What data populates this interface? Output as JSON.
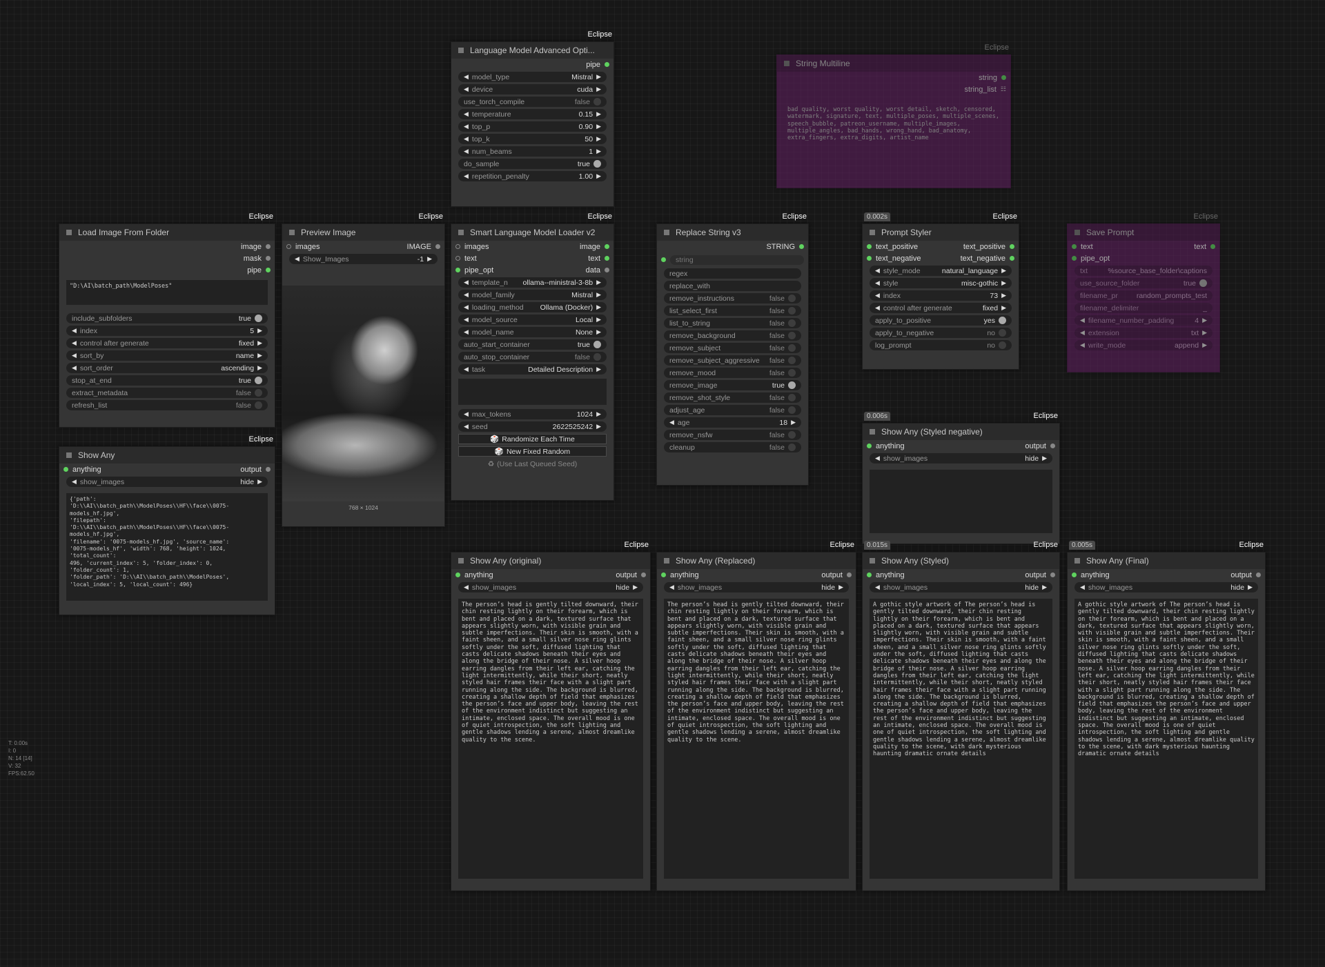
{
  "badge": "Eclipse",
  "stats": [
    "T: 0.00s",
    "I: 0",
    "N: 14 [14]",
    "V: 32",
    "FPS:62.50"
  ],
  "lmao": {
    "title": "Language Model Advanced Opti...",
    "out": "pipe",
    "w": [
      {
        "label": "model_type",
        "value": "Mistral"
      },
      {
        "label": "device",
        "value": "cuda"
      },
      {
        "label": "use_torch_compile",
        "value": "false"
      },
      {
        "label": "temperature",
        "value": "0.15"
      },
      {
        "label": "top_p",
        "value": "0.90"
      },
      {
        "label": "top_k",
        "value": "50"
      },
      {
        "label": "num_beams",
        "value": "1"
      },
      {
        "label": "do_sample",
        "value": "true"
      },
      {
        "label": "repetition_penalty",
        "value": "1.00"
      }
    ]
  },
  "strml": {
    "title": "String Multiline",
    "out1": "string",
    "out2": "string_list",
    "text": "bad quality, worst quality, worst detail, sketch, censored, watermark, signature, text, multiple_poses, multiple_scenes, speech_bubble, patreon_username, multiple_images, multiple_angles, bad_hands, wrong_hand, bad_anatomy, extra_fingers, extra_digits, artist_name"
  },
  "lif": {
    "title": "Load Image From Folder",
    "outs": [
      "image",
      "mask",
      "pipe"
    ],
    "path": "\"D:\\AI\\batch_path\\ModelPoses\"",
    "w": [
      {
        "label": "include_subfolders",
        "value": "true"
      },
      {
        "label": "index",
        "value": "5"
      },
      {
        "label": "control after generate",
        "value": "fixed"
      },
      {
        "label": "sort_by",
        "value": "name"
      },
      {
        "label": "sort_order",
        "value": "ascending"
      },
      {
        "label": "stop_at_end",
        "value": "true"
      },
      {
        "label": "extract_metadata",
        "value": "false"
      },
      {
        "label": "refresh_list",
        "value": "false"
      }
    ]
  },
  "prev": {
    "title": "Preview Image",
    "in": "images",
    "out": "IMAGE",
    "w": {
      "label": "Show_Images",
      "value": "-1"
    },
    "dims": "768 × 1024"
  },
  "slml": {
    "title": "Smart Language Model Loader v2",
    "ios": [
      [
        "images",
        "image"
      ],
      [
        "text",
        "text"
      ],
      [
        "pipe_opt",
        "data"
      ]
    ],
    "w": [
      {
        "label": "template_n",
        "value": "ollama--ministral-3-8b"
      },
      {
        "label": "model_family",
        "value": "Mistral"
      },
      {
        "label": "loading_method",
        "value": "Ollama (Docker)"
      },
      {
        "label": "model_source",
        "value": "Local"
      },
      {
        "label": "model_name",
        "value": "None"
      },
      {
        "label": "auto_start_container",
        "value": "true"
      },
      {
        "label": "auto_stop_container",
        "value": "false"
      },
      {
        "label": "task",
        "value": "Detailed Description"
      }
    ],
    "w2": [
      {
        "label": "max_tokens",
        "value": "1024"
      },
      {
        "label": "seed",
        "value": "2622525242"
      }
    ],
    "btns": [
      "Randomize Each Time",
      "New Fixed Random",
      "(Use Last Queued Seed)"
    ]
  },
  "rs": {
    "title": "Replace String v3",
    "out": "STRING",
    "str": "string",
    "w": [
      {
        "label": "regex",
        "value": ""
      },
      {
        "label": "replace_with",
        "value": ""
      },
      {
        "label": "remove_instructions",
        "value": "false"
      },
      {
        "label": "list_select_first",
        "value": "false"
      },
      {
        "label": "list_to_string",
        "value": "false"
      },
      {
        "label": "remove_background",
        "value": "false"
      },
      {
        "label": "remove_subject",
        "value": "false"
      },
      {
        "label": "remove_subject_aggressive",
        "value": "false"
      },
      {
        "label": "remove_mood",
        "value": "false"
      },
      {
        "label": "remove_image",
        "value": "true"
      },
      {
        "label": "remove_shot_style",
        "value": "false"
      },
      {
        "label": "adjust_age",
        "value": "false"
      },
      {
        "label": "age",
        "value": "18"
      },
      {
        "label": "remove_nsfw",
        "value": "false"
      },
      {
        "label": "cleanup",
        "value": "false"
      }
    ]
  },
  "ps": {
    "title": "Prompt Styler",
    "timer": "0.002s",
    "ios": [
      [
        "text_positive",
        "text_positive"
      ],
      [
        "text_negative",
        "text_negative"
      ]
    ],
    "w": [
      {
        "label": "style_mode",
        "value": "natural_language"
      },
      {
        "label": "style",
        "value": "misc-gothic"
      },
      {
        "label": "index",
        "value": "73"
      },
      {
        "label": "control after generate",
        "value": "fixed"
      },
      {
        "label": "apply_to_positive",
        "value": "yes"
      },
      {
        "label": "apply_to_negative",
        "value": "no"
      },
      {
        "label": "log_prompt",
        "value": "no"
      }
    ]
  },
  "sp": {
    "title": "Save Prompt",
    "ios": [
      [
        "text",
        "text"
      ],
      [
        "pipe_opt",
        ""
      ]
    ],
    "w": [
      {
        "label": "txt",
        "value": "%source_base_folder\\captions"
      },
      {
        "label": "use_source_folder",
        "value": "true"
      },
      {
        "label": "filename_pr",
        "value": "random_prompts_test"
      },
      {
        "label": "filename_delimiter",
        "value": "_"
      },
      {
        "label": "filename_number_padding",
        "value": "4"
      },
      {
        "label": "extension",
        "value": "txt"
      },
      {
        "label": "write_mode",
        "value": "append"
      }
    ]
  },
  "sa1": {
    "title": "Show Any",
    "in": "anything",
    "out": "output",
    "w": {
      "label": "show_images",
      "value": "hide"
    },
    "text": "{'path':\n'D:\\\\AI\\\\batch_path\\\\ModelPoses\\\\HF\\\\face\\\\0075-models_hf.jpg',\n'filepath':\n'D:\\\\AI\\\\batch_path\\\\ModelPoses\\\\HF\\\\face\\\\0075-models_hf.jpg',\n'filename': '0075-models_hf.jpg', 'source_name':\n'0075-models_hf', 'width': 768, 'height': 1024, 'total_count':\n496, 'current_index': 5, 'folder_index': 0, 'folder_count': 1,\n'folder_path': 'D:\\\\AI\\\\batch_path\\\\ModelPoses',\n'local_index': 5, 'local_count': 496}"
  },
  "sasn": {
    "title": "Show Any (Styled negative)",
    "timer": "0.006s",
    "in": "anything",
    "out": "output",
    "w": {
      "label": "show_images",
      "value": "hide"
    }
  },
  "sao": {
    "title": "Show Any (original)",
    "in": "anything",
    "out": "output",
    "w": {
      "label": "show_images",
      "value": "hide"
    },
    "text": "The person’s head is gently tilted downward, their chin resting lightly on their forearm, which is bent and placed on a dark, textured surface that appears slightly worn, with visible grain and subtle imperfections. Their skin is smooth, with a faint sheen, and a small silver nose ring glints softly under the soft, diffused lighting that casts delicate shadows beneath their eyes and along the bridge of their nose. A silver hoop earring dangles from their left ear, catching the light intermittently, while their short, neatly styled hair frames their face with a slight part running along the side. The background is blurred, creating a shallow depth of field that emphasizes the person’s face and upper body, leaving the rest of the environment indistinct but suggesting an intimate, enclosed space. The overall mood is one of quiet introspection, the soft lighting and gentle shadows lending a serene, almost dreamlike quality to the scene."
  },
  "sar": {
    "title": "Show Any (Replaced)",
    "in": "anything",
    "out": "output",
    "w": {
      "label": "show_images",
      "value": "hide"
    },
    "text": "The person’s head is gently tilted downward, their chin resting lightly on their forearm, which is bent and placed on a dark, textured surface that appears slightly worn, with visible grain and subtle imperfections. Their skin is smooth, with a faint sheen, and a small silver nose ring glints softly under the soft, diffused lighting that casts delicate shadows beneath their eyes and along the bridge of their nose. A silver hoop earring dangles from their left ear, catching the light intermittently, while their short, neatly styled hair frames their face with a slight part running along the side. The background is blurred, creating a shallow depth of field that emphasizes the person’s face and upper body, leaving the rest of the environment indistinct but suggesting an intimate, enclosed space. The overall mood is one of quiet introspection, the soft lighting and gentle shadows lending a serene, almost dreamlike quality to the scene."
  },
  "sas": {
    "title": "Show Any (Styled)",
    "timer": "0.015s",
    "in": "anything",
    "out": "output",
    "w": {
      "label": "show_images",
      "value": "hide"
    },
    "text": "A gothic style artwork of The person’s head is gently tilted downward, their chin resting lightly on their forearm, which is bent and placed on a dark, textured surface that appears slightly worn, with visible grain and subtle imperfections. Their skin is smooth, with a faint sheen, and a small silver nose ring glints softly under the soft, diffused lighting that casts delicate shadows beneath their eyes and along the bridge of their nose. A silver hoop earring dangles from their left ear, catching the light intermittently, while their short, neatly styled hair frames their face with a slight part running along the side. The background is blurred, creating a shallow depth of field that emphasizes the person’s face and upper body, leaving the rest of the environment indistinct but suggesting an intimate, enclosed space. The overall mood is one of quiet introspection, the soft lighting and gentle shadows lending a serene, almost dreamlike quality to the scene, with dark mysterious haunting dramatic ornate details"
  },
  "saf": {
    "title": "Show Any (Final)",
    "timer": "0.005s",
    "in": "anything",
    "out": "output",
    "w": {
      "label": "show_images",
      "value": "hide"
    },
    "text": "A gothic style artwork of The person’s head is gently tilted downward, their chin resting lightly on their forearm, which is bent and placed on a dark, textured surface that appears slightly worn, with visible grain and subtle imperfections. Their skin is smooth, with a faint sheen, and a small silver nose ring glints softly under the soft, diffused lighting that casts delicate shadows beneath their eyes and along the bridge of their nose. A silver hoop earring dangles from their left ear, catching the light intermittently, while their short, neatly styled hair frames their face with a slight part running along the side. The background is blurred, creating a shallow depth of field that emphasizes the person’s face and upper body, leaving the rest of the environment indistinct but suggesting an intimate, enclosed space. The overall mood is one of quiet introspection, the soft lighting and gentle shadows lending a serene, almost dreamlike quality to the scene, with dark mysterious haunting dramatic ornate details"
  }
}
